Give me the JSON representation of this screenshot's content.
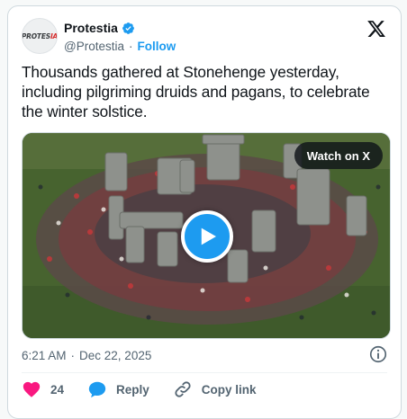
{
  "author": {
    "display_name": "Protestia",
    "handle": "@Protestia",
    "follow_label": "Follow",
    "avatar_text_a": "PROTES",
    "avatar_text_b": "IA",
    "verified_icon": "verified-badge-icon"
  },
  "tweet": {
    "text": "Thousands gathered at Stonehenge yesterday, including pilgriming druids and pagans, to celebrate the winter solstice.",
    "time": "6:21 AM",
    "date": "Dec 22, 2025",
    "separator": "·"
  },
  "media": {
    "watch_label": "Watch on X",
    "play_icon": "play-icon"
  },
  "actions": {
    "like_count": "24",
    "reply_label": "Reply",
    "copy_label": "Copy link"
  },
  "colors": {
    "accent": "#1d9bf0",
    "like": "#f91880",
    "text": "#0f1419",
    "muted": "#536471"
  }
}
